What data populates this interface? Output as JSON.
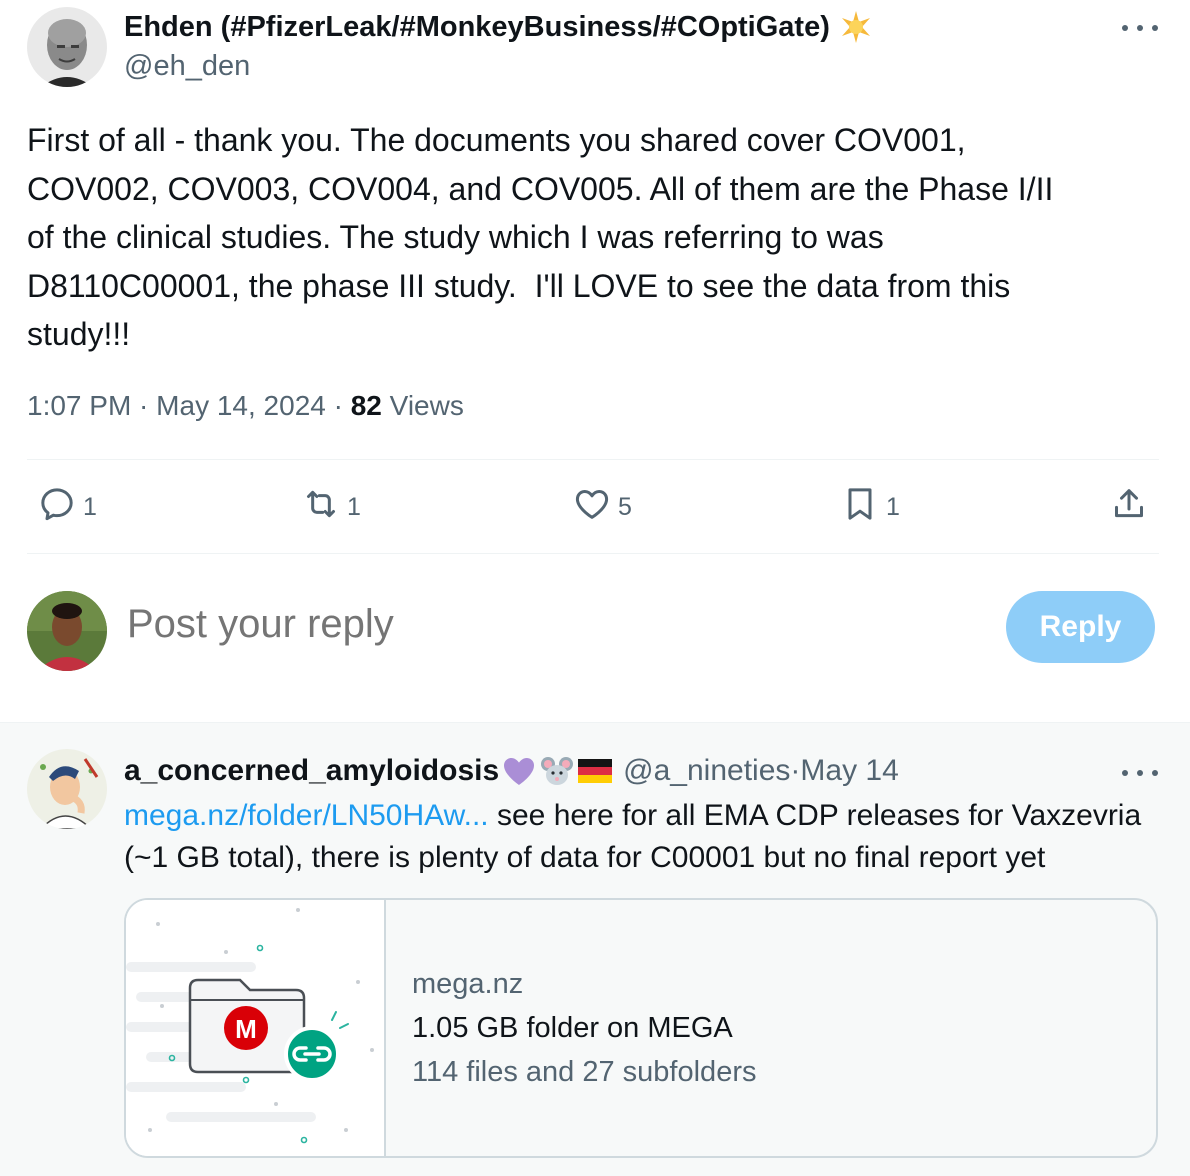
{
  "main_tweet": {
    "author_name": "Ehden (#PfizerLeak/#MonkeyBusiness/#COptiGate)",
    "author_handle": "@eh_den",
    "text": "First of all - thank you. The documents you shared cover COV001,\nCOV002, COV003, COV004, and COV005. All of them are the Phase I/II\nof the clinical studies. The study which I was referring to was\nD8110C00001, the phase III study.  I'll LOVE to see the data from this\nstudy!!!",
    "time": "1:07 PM",
    "separator": " · ",
    "date": "May 14, 2024",
    "views_count": "82",
    "views_label": " Views"
  },
  "actions": {
    "replies": "1",
    "reposts": "1",
    "likes": "5",
    "bookmarks": "1"
  },
  "reply_box": {
    "placeholder": "Post your reply",
    "button_label": "Reply"
  },
  "reply_tweet": {
    "author_name": "a_concerned_amyloidosis",
    "author_handle": "@a_nineties",
    "separator": " · ",
    "date": "May 14",
    "link_text": "mega.nz/folder/LN50HAw...",
    "text": " see here for all EMA CDP releases for Vaxzevria (~1 GB total), there is plenty of data for C00001 but no final report yet",
    "card": {
      "domain": "mega.nz",
      "title": "1.05 GB folder on MEGA",
      "description": "114 files and 27 subfolders",
      "logo_letter": "M"
    }
  },
  "colors": {
    "text_primary": "#0f1419",
    "text_secondary": "#536471",
    "link": "#1d9bf0",
    "reply_button_disabled": "#8ecdf8",
    "mega_red": "#d90007",
    "link_green": "#00a382"
  }
}
